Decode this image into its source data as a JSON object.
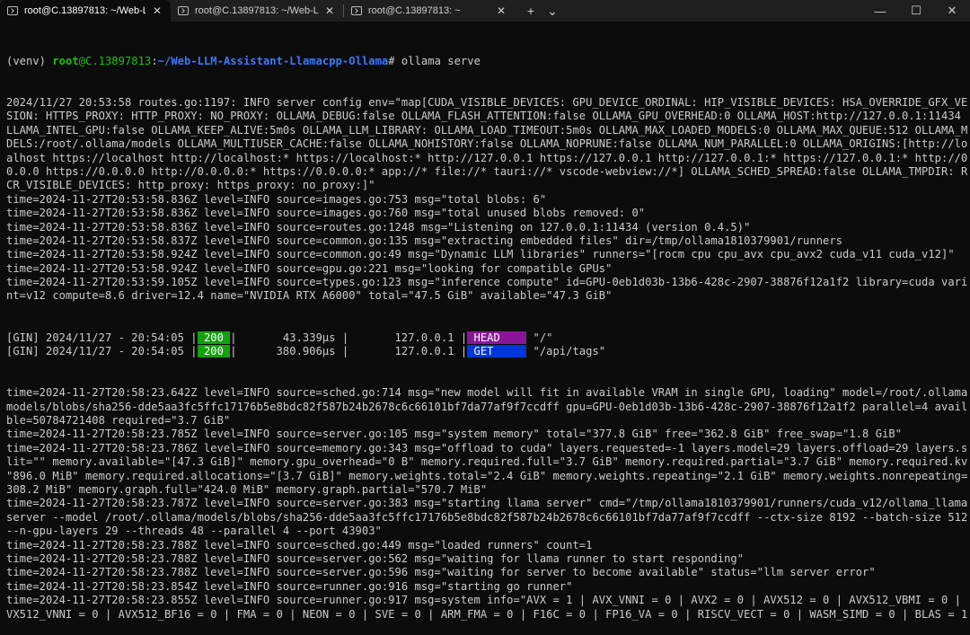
{
  "tabs": [
    {
      "title": "root@C.13897813: ~/Web-LLM",
      "active": true
    },
    {
      "title": "root@C.13897813: ~/Web-LLM",
      "active": false
    },
    {
      "title": "root@C.13897813: ~",
      "active": false
    }
  ],
  "prompt": {
    "venv": "(venv) ",
    "user": "root",
    "host": "@C.13897813",
    "colon": ":",
    "path": "~/Web-LLM-Assistant-Llamacpp-Ollama",
    "symbol": "# ",
    "command": "ollama serve"
  },
  "lines_a": [
    "2024/11/27 20:53:58 routes.go:1197: INFO server config env=\"map[CUDA_VISIBLE_DEVICES: GPU_DEVICE_ORDINAL: HIP_VISIBLE_DEVICES: HSA_OVERRIDE_GFX_VER",
    "SION: HTTPS_PROXY: HTTP_PROXY: NO_PROXY: OLLAMA_DEBUG:false OLLAMA_FLASH_ATTENTION:false OLLAMA_GPU_OVERHEAD:0 OLLAMA_HOST:http://127.0.0.1:11434 O",
    "LLAMA_INTEL_GPU:false OLLAMA_KEEP_ALIVE:5m0s OLLAMA_LLM_LIBRARY: OLLAMA_LOAD_TIMEOUT:5m0s OLLAMA_MAX_LOADED_MODELS:0 OLLAMA_MAX_QUEUE:512 OLLAMA_MO",
    "DELS:/root/.ollama/models OLLAMA_MULTIUSER_CACHE:false OLLAMA_NOHISTORY:false OLLAMA_NOPRUNE:false OLLAMA_NUM_PARALLEL:0 OLLAMA_ORIGINS:[http://loc",
    "alhost https://localhost http://localhost:* https://localhost:* http://127.0.0.1 https://127.0.0.1 http://127.0.0.1:* https://127.0.0.1:* http://0.",
    "0.0.0 https://0.0.0.0 http://0.0.0.0:* https://0.0.0.0:* app://* file://* tauri://* vscode-webview://*] OLLAMA_SCHED_SPREAD:false OLLAMA_TMPDIR: RO",
    "CR_VISIBLE_DEVICES: http_proxy: https_proxy: no_proxy:]\"",
    "time=2024-11-27T20:53:58.836Z level=INFO source=images.go:753 msg=\"total blobs: 6\"",
    "time=2024-11-27T20:53:58.836Z level=INFO source=images.go:760 msg=\"total unused blobs removed: 0\"",
    "time=2024-11-27T20:53:58.836Z level=INFO source=routes.go:1248 msg=\"Listening on 127.0.0.1:11434 (version 0.4.5)\"",
    "time=2024-11-27T20:53:58.837Z level=INFO source=common.go:135 msg=\"extracting embedded files\" dir=/tmp/ollama1810379901/runners",
    "time=2024-11-27T20:53:58.924Z level=INFO source=common.go:49 msg=\"Dynamic LLM libraries\" runners=\"[rocm cpu cpu_avx cpu_avx2 cuda_v11 cuda_v12]\"",
    "time=2024-11-27T20:53:58.924Z level=INFO source=gpu.go:221 msg=\"looking for compatible GPUs\"",
    "time=2024-11-27T20:53:59.105Z level=INFO source=types.go:123 msg=\"inference compute\" id=GPU-0eb1d03b-13b6-428c-2907-38876f12a1f2 library=cuda varia",
    "nt=v12 compute=8.6 driver=12.4 name=\"NVIDIA RTX A6000\" total=\"47.5 GiB\" available=\"47.3 GiB\""
  ],
  "gin": [
    {
      "prefix": "[GIN] 2024/11/27 - 20:54:05 |",
      "status": " 200 ",
      "mid": "|       43.339µs |       127.0.0.1 |",
      "method": " HEAD    ",
      "method_color": "purple",
      "path": " \"/\""
    },
    {
      "prefix": "[GIN] 2024/11/27 - 20:54:05 |",
      "status": " 200 ",
      "mid": "|      380.906µs |       127.0.0.1 |",
      "method": " GET     ",
      "method_color": "blue",
      "path": " \"/api/tags\""
    }
  ],
  "lines_b": [
    "time=2024-11-27T20:58:23.642Z level=INFO source=sched.go:714 msg=\"new model will fit in available VRAM in single GPU, loading\" model=/root/.ollama/",
    "models/blobs/sha256-dde5aa3fc5ffc17176b5e8bdc82f587b24b2678c6c66101bf7da77af9f7ccdff gpu=GPU-0eb1d03b-13b6-428c-2907-38876f12a1f2 parallel=4 availa",
    "ble=50784721408 required=\"3.7 GiB\"",
    "time=2024-11-27T20:58:23.785Z level=INFO source=server.go:105 msg=\"system memory\" total=\"377.8 GiB\" free=\"362.8 GiB\" free_swap=\"1.8 GiB\"",
    "time=2024-11-27T20:58:23.786Z level=INFO source=memory.go:343 msg=\"offload to cuda\" layers.requested=-1 layers.model=29 layers.offload=29 layers.sp",
    "lit=\"\" memory.available=\"[47.3 GiB]\" memory.gpu_overhead=\"0 B\" memory.required.full=\"3.7 GiB\" memory.required.partial=\"3.7 GiB\" memory.required.kv=",
    "\"896.0 MiB\" memory.required.allocations=\"[3.7 GiB]\" memory.weights.total=\"2.4 GiB\" memory.weights.repeating=\"2.1 GiB\" memory.weights.nonrepeating=\"",
    "308.2 MiB\" memory.graph.full=\"424.0 MiB\" memory.graph.partial=\"570.7 MiB\"",
    "time=2024-11-27T20:58:23.787Z level=INFO source=server.go:383 msg=\"starting llama server\" cmd=\"/tmp/ollama1810379901/runners/cuda_v12/ollama_llama_",
    "server --model /root/.ollama/models/blobs/sha256-dde5aa3fc5ffc17176b5e8bdc82f587b24b2678c6c66101bf7da77af9f7ccdff --ctx-size 8192 --batch-size 512",
    "--n-gpu-layers 29 --threads 48 --parallel 4 --port 43903\"",
    "time=2024-11-27T20:58:23.788Z level=INFO source=sched.go:449 msg=\"loaded runners\" count=1",
    "time=2024-11-27T20:58:23.788Z level=INFO source=server.go:562 msg=\"waiting for llama runner to start responding\"",
    "time=2024-11-27T20:58:23.788Z level=INFO source=server.go:596 msg=\"waiting for server to become available\" status=\"llm server error\"",
    "time=2024-11-27T20:58:23.854Z level=INFO source=runner.go:916 msg=\"starting go runner\"",
    "time=2024-11-27T20:58:23.855Z level=INFO source=runner.go:917 msg=system info=\"AVX = 1 | AVX_VNNI = 0 | AVX2 = 0 | AVX512 = 0 | AVX512_VBMI = 0 | A",
    "VX512_VNNI = 0 | AVX512_BF16 = 0 | FMA = 0 | NEON = 0 | SVE = 0 | ARM_FMA = 0 | F16C = 0 | FP16_VA = 0 | RISCV_VECT = 0 | WASM_SIMD = 0 | BLAS = 1"
  ],
  "icons": {
    "tab_icon": "terminal-icon",
    "close": "✕",
    "new_tab": "+",
    "dropdown": "⌄",
    "minimize": "—",
    "maximize": "☐",
    "window_close": "✕"
  },
  "colors": {
    "background": "#0c0c0c",
    "text": "#cccccc",
    "prompt_user": "#16c60c",
    "prompt_path": "#3b78ff",
    "status_200": "#13a10e",
    "method_head": "#881798",
    "method_get": "#0037da"
  }
}
